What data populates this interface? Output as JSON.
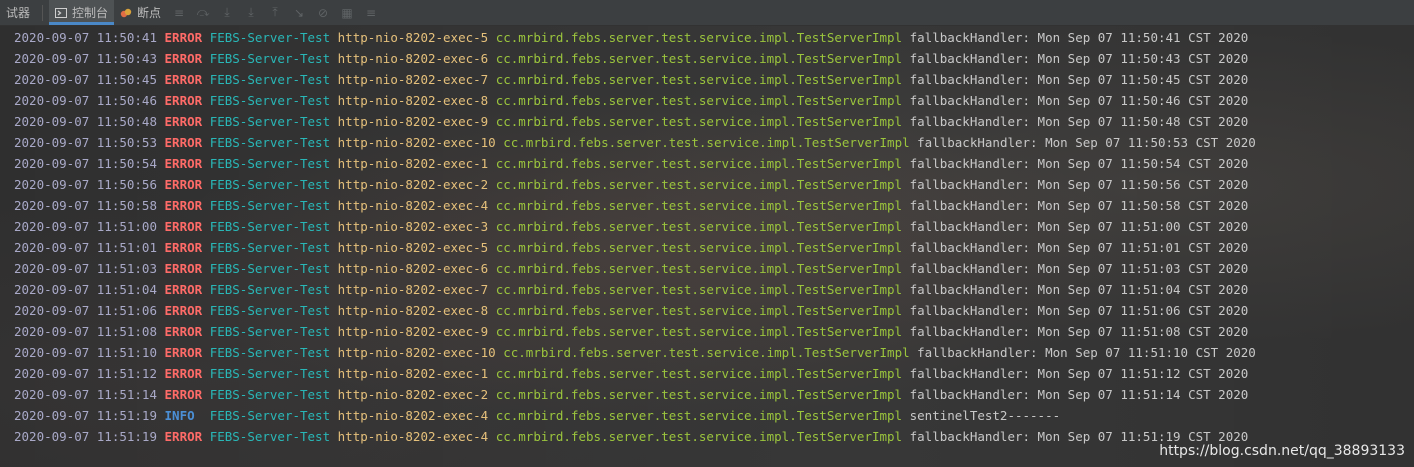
{
  "toolbar": {
    "debugger_tab": "试器",
    "console_tab": "控制台",
    "breakpoints_tab": "断点",
    "icons": [
      "menu-icon",
      "step-over-icon",
      "step-into-icon",
      "force-step-into-icon",
      "step-out-icon",
      "run-to-cursor-icon",
      "evaluate-icon",
      "table-icon"
    ]
  },
  "logs": [
    {
      "ts": "2020-09-07 11:50:41",
      "level": "ERROR",
      "service": "FEBS-Server-Test",
      "thread": "http-nio-8202-exec-5",
      "cls": "cc.mrbird.febs.server.test.service.impl.TestServerImpl",
      "msg": "fallbackHandler: Mon Sep 07 11:50:41 CST 2020"
    },
    {
      "ts": "2020-09-07 11:50:43",
      "level": "ERROR",
      "service": "FEBS-Server-Test",
      "thread": "http-nio-8202-exec-6",
      "cls": "cc.mrbird.febs.server.test.service.impl.TestServerImpl",
      "msg": "fallbackHandler: Mon Sep 07 11:50:43 CST 2020"
    },
    {
      "ts": "2020-09-07 11:50:45",
      "level": "ERROR",
      "service": "FEBS-Server-Test",
      "thread": "http-nio-8202-exec-7",
      "cls": "cc.mrbird.febs.server.test.service.impl.TestServerImpl",
      "msg": "fallbackHandler: Mon Sep 07 11:50:45 CST 2020"
    },
    {
      "ts": "2020-09-07 11:50:46",
      "level": "ERROR",
      "service": "FEBS-Server-Test",
      "thread": "http-nio-8202-exec-8",
      "cls": "cc.mrbird.febs.server.test.service.impl.TestServerImpl",
      "msg": "fallbackHandler: Mon Sep 07 11:50:46 CST 2020"
    },
    {
      "ts": "2020-09-07 11:50:48",
      "level": "ERROR",
      "service": "FEBS-Server-Test",
      "thread": "http-nio-8202-exec-9",
      "cls": "cc.mrbird.febs.server.test.service.impl.TestServerImpl",
      "msg": "fallbackHandler: Mon Sep 07 11:50:48 CST 2020"
    },
    {
      "ts": "2020-09-07 11:50:53",
      "level": "ERROR",
      "service": "FEBS-Server-Test",
      "thread": "http-nio-8202-exec-10",
      "cls": "cc.mrbird.febs.server.test.service.impl.TestServerImpl",
      "msg": "fallbackHandler: Mon Sep 07 11:50:53 CST 2020"
    },
    {
      "ts": "2020-09-07 11:50:54",
      "level": "ERROR",
      "service": "FEBS-Server-Test",
      "thread": "http-nio-8202-exec-1",
      "cls": "cc.mrbird.febs.server.test.service.impl.TestServerImpl",
      "msg": "fallbackHandler: Mon Sep 07 11:50:54 CST 2020"
    },
    {
      "ts": "2020-09-07 11:50:56",
      "level": "ERROR",
      "service": "FEBS-Server-Test",
      "thread": "http-nio-8202-exec-2",
      "cls": "cc.mrbird.febs.server.test.service.impl.TestServerImpl",
      "msg": "fallbackHandler: Mon Sep 07 11:50:56 CST 2020"
    },
    {
      "ts": "2020-09-07 11:50:58",
      "level": "ERROR",
      "service": "FEBS-Server-Test",
      "thread": "http-nio-8202-exec-4",
      "cls": "cc.mrbird.febs.server.test.service.impl.TestServerImpl",
      "msg": "fallbackHandler: Mon Sep 07 11:50:58 CST 2020"
    },
    {
      "ts": "2020-09-07 11:51:00",
      "level": "ERROR",
      "service": "FEBS-Server-Test",
      "thread": "http-nio-8202-exec-3",
      "cls": "cc.mrbird.febs.server.test.service.impl.TestServerImpl",
      "msg": "fallbackHandler: Mon Sep 07 11:51:00 CST 2020"
    },
    {
      "ts": "2020-09-07 11:51:01",
      "level": "ERROR",
      "service": "FEBS-Server-Test",
      "thread": "http-nio-8202-exec-5",
      "cls": "cc.mrbird.febs.server.test.service.impl.TestServerImpl",
      "msg": "fallbackHandler: Mon Sep 07 11:51:01 CST 2020"
    },
    {
      "ts": "2020-09-07 11:51:03",
      "level": "ERROR",
      "service": "FEBS-Server-Test",
      "thread": "http-nio-8202-exec-6",
      "cls": "cc.mrbird.febs.server.test.service.impl.TestServerImpl",
      "msg": "fallbackHandler: Mon Sep 07 11:51:03 CST 2020"
    },
    {
      "ts": "2020-09-07 11:51:04",
      "level": "ERROR",
      "service": "FEBS-Server-Test",
      "thread": "http-nio-8202-exec-7",
      "cls": "cc.mrbird.febs.server.test.service.impl.TestServerImpl",
      "msg": "fallbackHandler: Mon Sep 07 11:51:04 CST 2020"
    },
    {
      "ts": "2020-09-07 11:51:06",
      "level": "ERROR",
      "service": "FEBS-Server-Test",
      "thread": "http-nio-8202-exec-8",
      "cls": "cc.mrbird.febs.server.test.service.impl.TestServerImpl",
      "msg": "fallbackHandler: Mon Sep 07 11:51:06 CST 2020"
    },
    {
      "ts": "2020-09-07 11:51:08",
      "level": "ERROR",
      "service": "FEBS-Server-Test",
      "thread": "http-nio-8202-exec-9",
      "cls": "cc.mrbird.febs.server.test.service.impl.TestServerImpl",
      "msg": "fallbackHandler: Mon Sep 07 11:51:08 CST 2020"
    },
    {
      "ts": "2020-09-07 11:51:10",
      "level": "ERROR",
      "service": "FEBS-Server-Test",
      "thread": "http-nio-8202-exec-10",
      "cls": "cc.mrbird.febs.server.test.service.impl.TestServerImpl",
      "msg": "fallbackHandler: Mon Sep 07 11:51:10 CST 2020"
    },
    {
      "ts": "2020-09-07 11:51:12",
      "level": "ERROR",
      "service": "FEBS-Server-Test",
      "thread": "http-nio-8202-exec-1",
      "cls": "cc.mrbird.febs.server.test.service.impl.TestServerImpl",
      "msg": "fallbackHandler: Mon Sep 07 11:51:12 CST 2020"
    },
    {
      "ts": "2020-09-07 11:51:14",
      "level": "ERROR",
      "service": "FEBS-Server-Test",
      "thread": "http-nio-8202-exec-2",
      "cls": "cc.mrbird.febs.server.test.service.impl.TestServerImpl",
      "msg": "fallbackHandler: Mon Sep 07 11:51:14 CST 2020"
    },
    {
      "ts": "2020-09-07 11:51:19",
      "level": "INFO",
      "service": "FEBS-Server-Test",
      "thread": "http-nio-8202-exec-4",
      "cls": "cc.mrbird.febs.server.test.service.impl.TestServerImpl",
      "msg": "sentinelTest2-------"
    },
    {
      "ts": "2020-09-07 11:51:19",
      "level": "ERROR",
      "service": "FEBS-Server-Test",
      "thread": "http-nio-8202-exec-4",
      "cls": "cc.mrbird.febs.server.test.service.impl.TestServerImpl",
      "msg": "fallbackHandler: Mon Sep 07 11:51:19 CST 2020"
    }
  ],
  "watermark": "https://blog.csdn.net/qq_38893133"
}
